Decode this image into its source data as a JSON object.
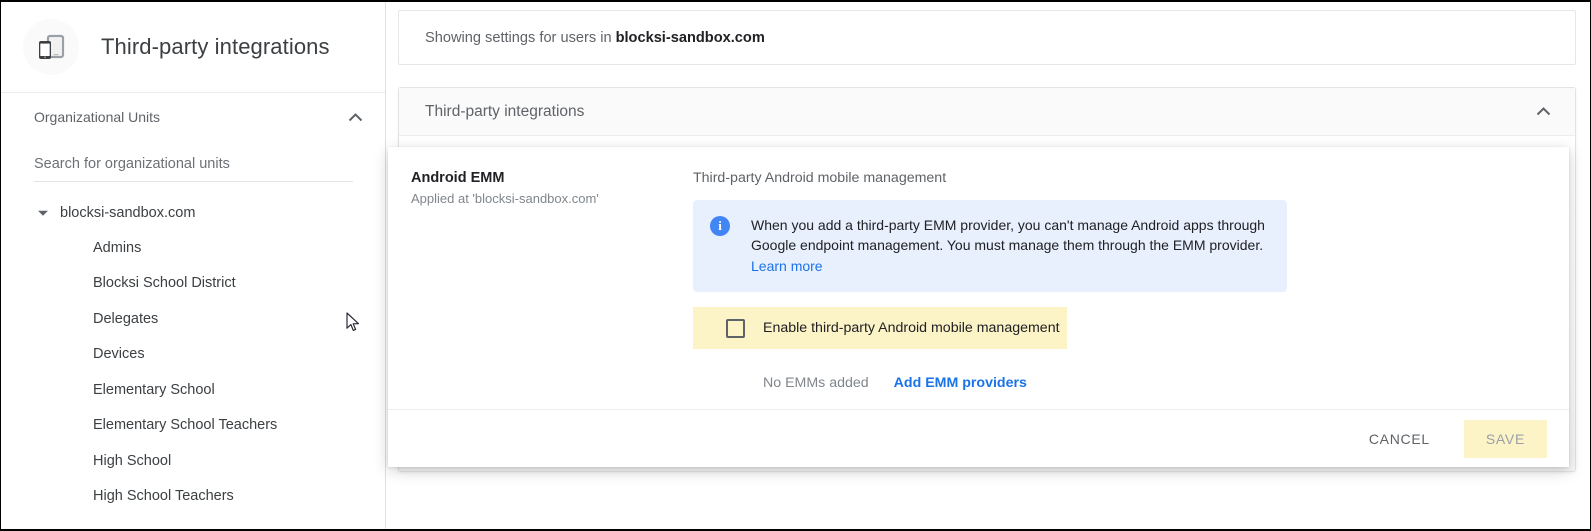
{
  "sidebar": {
    "app_icon": "devices-phone-tablet-icon",
    "title": "Third-party integrations",
    "org_units": {
      "header_label": "Organizational Units",
      "collapse_icon": "chevron-up-icon",
      "search_placeholder": "Search for organizational units",
      "search_value": "",
      "tree": {
        "root_label": "blocksi-sandbox.com",
        "root_caret_icon": "caret-down-icon",
        "children": [
          {
            "label": "Admins"
          },
          {
            "label": "Blocksi School District"
          },
          {
            "label": "Delegates"
          },
          {
            "label": "Devices"
          },
          {
            "label": "Elementary School"
          },
          {
            "label": "Elementary School Teachers"
          },
          {
            "label": "High School"
          },
          {
            "label": "High School Teachers"
          }
        ]
      }
    }
  },
  "content": {
    "showing_bar": {
      "prefix": "Showing settings for users in",
      "domain": "blocksi-sandbox.com"
    },
    "card": {
      "title": "Third-party integrations",
      "collapse_icon": "chevron-up-icon"
    }
  },
  "panel": {
    "left": {
      "heading": "Android EMM",
      "applied_at": "Applied at 'blocksi-sandbox.com'"
    },
    "right": {
      "section_label": "Third-party Android mobile management",
      "info_box": {
        "icon": "info-circle-icon",
        "text": "When you add a third-party EMM provider, you can't manage Android apps through Google endpoint management. You must manage them through the EMM provider.",
        "link_label": "Learn more"
      },
      "enable_checkbox": {
        "label": "Enable third-party Android mobile management",
        "checked": false
      },
      "status": {
        "no_emms_label": "No EMMs added",
        "add_link_label": "Add EMM providers"
      }
    },
    "footer": {
      "cancel_label": "CANCEL",
      "save_label": "SAVE"
    }
  },
  "colors": {
    "accent_blue": "#1a73e8",
    "info_bg": "#e8f0fe",
    "highlight_yellow": "#fcf3c7",
    "text_primary": "#202124",
    "text_secondary": "#5f6368"
  }
}
